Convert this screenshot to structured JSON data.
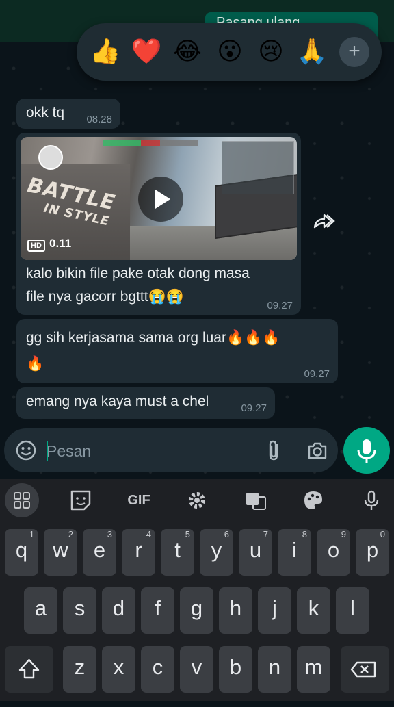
{
  "chat": {
    "sent_preview": "Pasang ulang",
    "reactions": [
      "👍",
      "❤️",
      "😂",
      "😮",
      "😢",
      "🙏"
    ],
    "reaction_add": "+",
    "messages": [
      {
        "text": "okk tq",
        "time": "08.28"
      },
      {
        "video": {
          "quality": "HD",
          "duration": "0.11",
          "overlay_text_line1": "BATTLE",
          "overlay_text_line2": "IN STYLE"
        },
        "text_line1": "kalo bikin file pake otak dong masa",
        "text_line2": "file nya gacorr bgttt😭😭",
        "time": "09.27"
      },
      {
        "text_line1": "gg sih kerjasama sama org luar🔥🔥🔥",
        "text_line2": "🔥",
        "time": "09.27"
      },
      {
        "text": "emang nya kaya must a chel",
        "time": "09.27"
      }
    ]
  },
  "composer": {
    "placeholder": "Pesan"
  },
  "keyboard": {
    "toolbar": [
      "apps",
      "sticker",
      "GIF",
      "settings",
      "translate",
      "theme",
      "voice"
    ],
    "row1": [
      {
        "k": "q",
        "h": "1"
      },
      {
        "k": "w",
        "h": "2"
      },
      {
        "k": "e",
        "h": "3"
      },
      {
        "k": "r",
        "h": "4"
      },
      {
        "k": "t",
        "h": "5"
      },
      {
        "k": "y",
        "h": "6"
      },
      {
        "k": "u",
        "h": "7"
      },
      {
        "k": "i",
        "h": "8"
      },
      {
        "k": "o",
        "h": "9"
      },
      {
        "k": "p",
        "h": "0"
      }
    ],
    "row2": [
      "a",
      "s",
      "d",
      "f",
      "g",
      "h",
      "j",
      "k",
      "l"
    ],
    "row3": [
      "z",
      "x",
      "c",
      "v",
      "b",
      "n",
      "m"
    ]
  },
  "colors": {
    "accent": "#00a884",
    "bubble": "#1f2c34",
    "background": "#0b141a"
  }
}
